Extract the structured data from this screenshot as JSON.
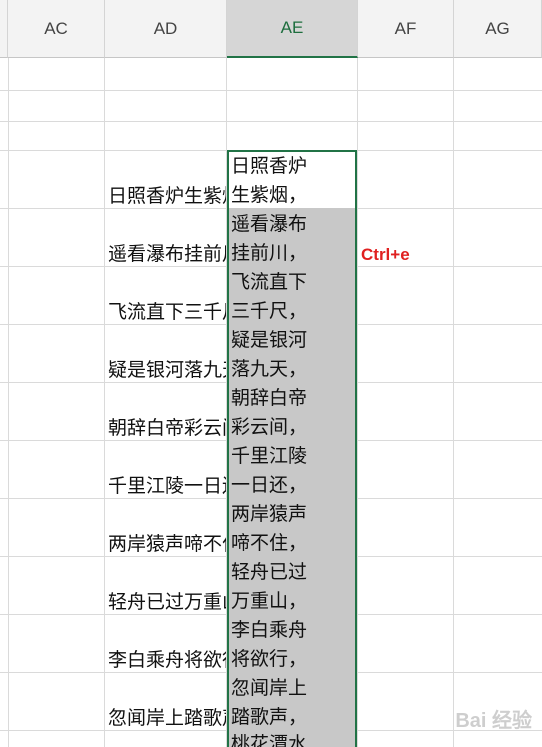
{
  "columns": [
    "AC",
    "AD",
    "AE",
    "AF",
    "AG"
  ],
  "active_column": "AE",
  "ad_cells": [
    "日照香炉生紫烟，",
    "遥看瀑布挂前川，",
    "飞流直下三千尺，",
    "疑是银河落九天，",
    "朝辞白帝彩云间，",
    "千里江陵一日还，",
    "两岸猿声啼不住，",
    "轻舟已过万重山，",
    "李白乘舟将欲行，",
    "忽闻岸上踏歌声，"
  ],
  "ae_lines": [
    "日照香炉",
    "生紫烟，",
    "遥看瀑布",
    "挂前川，",
    "飞流直下",
    "三千尺，",
    "疑是银河",
    "落九天，",
    "朝辞白帝",
    "彩云间，",
    "千里江陵",
    "一日还，",
    "两岸猿声",
    "啼不住，",
    "轻舟已过",
    "万重山，",
    "李白乘舟",
    "将欲行，",
    "忽闻岸上",
    "踏歌声，",
    "桃花潭水"
  ],
  "annotation": "Ctrl+e",
  "watermark": "Bai 经验",
  "colors": {
    "selection_border": "#217346",
    "selection_fill": "#c8c8c8",
    "annotation": "#e02020"
  }
}
